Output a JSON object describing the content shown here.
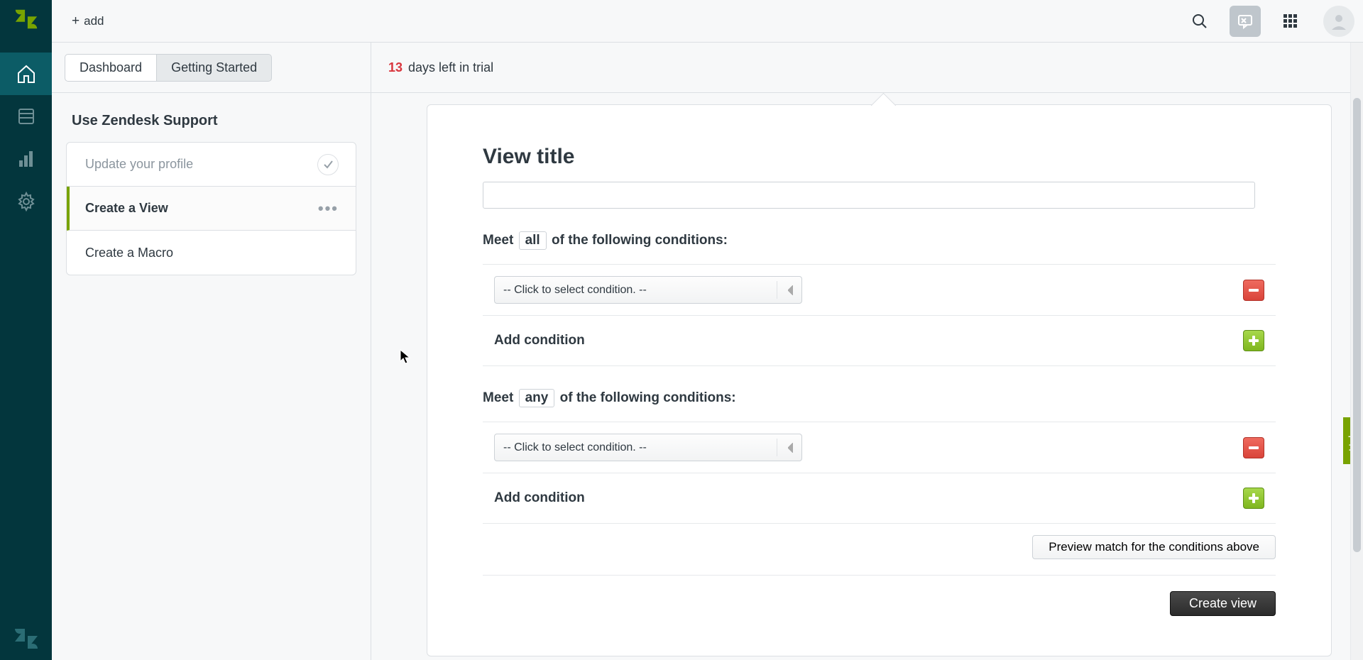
{
  "topbar": {
    "add_label": "add",
    "search_icon": "search-icon",
    "chat_icon": "chat-icon",
    "apps_icon": "apps-icon",
    "avatar_icon": "avatar-icon"
  },
  "trial": {
    "days": "13",
    "rest": "days left in trial"
  },
  "tabs": {
    "dashboard": "Dashboard",
    "getting_started": "Getting Started"
  },
  "section_title": "Use Zendesk Support",
  "tasks": [
    {
      "label": "Update your profile",
      "state": "done"
    },
    {
      "label": "Create a View",
      "state": "active"
    },
    {
      "label": "Create a Macro",
      "state": "pending"
    }
  ],
  "form": {
    "heading": "View title",
    "title_value": "",
    "meet_prefix": "Meet",
    "all_pill": "all",
    "any_pill": "any",
    "suffix": "of the following conditions:",
    "select_placeholder": "-- Click to select condition. --",
    "add_condition": "Add condition",
    "preview_label": "Preview match for the conditions above",
    "create_label": "Create view"
  },
  "help_tab": "Help",
  "colors": {
    "rail": "#03363d",
    "accent_green": "#78a300",
    "danger": "#d9363e"
  }
}
